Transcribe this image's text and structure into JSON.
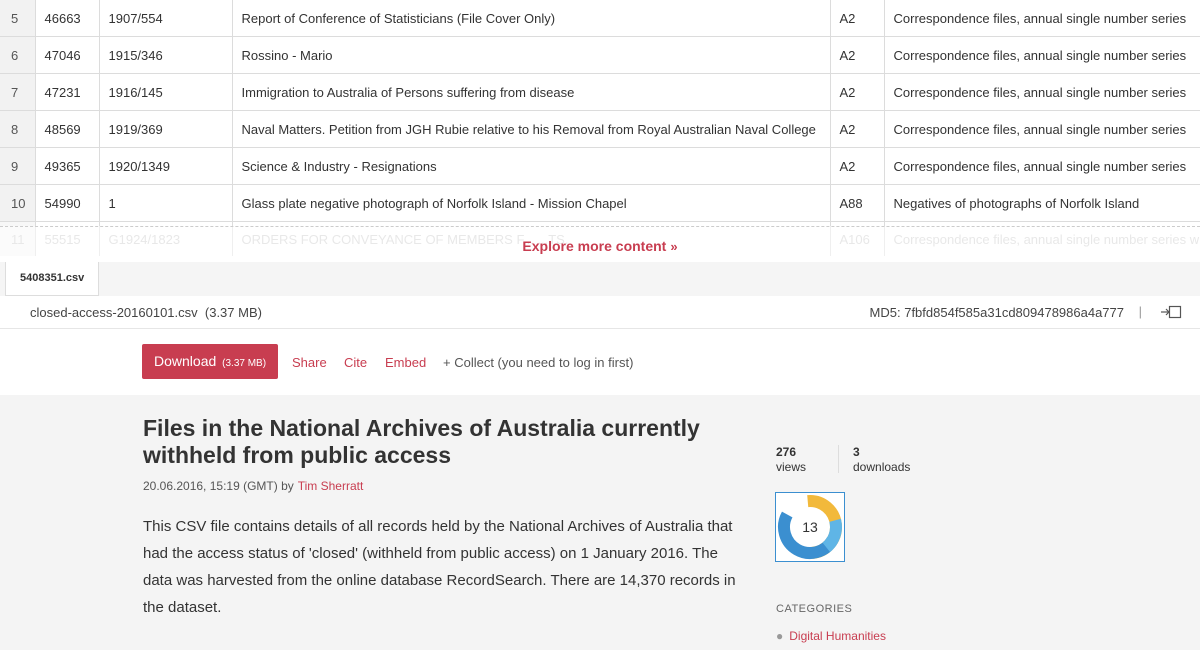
{
  "table": {
    "rows": [
      {
        "num": "5",
        "id": "46663",
        "control": "1907/554",
        "title": "Report of Conference of Statisticians (File Cover Only)",
        "series": "A2",
        "series_title": "Correspondence files, annual single number series"
      },
      {
        "num": "6",
        "id": "47046",
        "control": "1915/346",
        "title": "Rossino - Mario",
        "series": "A2",
        "series_title": "Correspondence files, annual single number series"
      },
      {
        "num": "7",
        "id": "47231",
        "control": "1916/145",
        "title": "Immigration to Australia of Persons suffering from disease",
        "series": "A2",
        "series_title": "Correspondence files, annual single number series"
      },
      {
        "num": "8",
        "id": "48569",
        "control": "1919/369",
        "title": "Naval Matters. Petition from JGH Rubie relative to his Removal from Royal Australian Naval College",
        "series": "A2",
        "series_title": "Correspondence files, annual single number series"
      },
      {
        "num": "9",
        "id": "49365",
        "control": "1920/1349",
        "title": "Science & Industry - Resignations",
        "series": "A2",
        "series_title": "Correspondence files, annual single number series"
      },
      {
        "num": "10",
        "id": "54990",
        "control": "1",
        "title": "Glass plate negative photograph of Norfolk Island - Mission Chapel",
        "series": "A88",
        "series_title": "Negatives of photographs of Norfolk Island"
      },
      {
        "num": "11",
        "id": "55515",
        "control": "G1924/1823",
        "title": "ORDERS FOR CONVEYANCE OF MEMBERS F... ...TS.",
        "series": "A106",
        "series_title": "Correspondence files, annual single number series with"
      }
    ],
    "explore_label": "Explore more content",
    "explore_icon": "double-chevron-down-icon"
  },
  "file_tab": {
    "label": "5408351.csv"
  },
  "file_info": {
    "filename": "closed-access-20160101.csv",
    "size": "(3.37 MB)",
    "md5": "MD5: 7fbfd854f585a31cd809478986a4a777",
    "separator": "|"
  },
  "actions": {
    "download_label": "Download",
    "download_size": "(3.37 MB)",
    "share": "Share",
    "cite": "Cite",
    "embed": "Embed",
    "collect": "+ Collect (you need to log in first)"
  },
  "article": {
    "title": "Files in the National Archives of Australia currently withheld from public access",
    "date": "20.06.2016, 15:19 (GMT) by",
    "author": "Tim Sherratt",
    "description": "This CSV file contains details of all records held by the National Archives of Australia that had the access status of 'closed' (withheld from public access) on 1 January 2016. The data was harvested from the online database RecordSearch. There are 14,370 records in the dataset."
  },
  "stats": {
    "views_count": "276",
    "views_label": "views",
    "downloads_count": "3",
    "downloads_label": "downloads"
  },
  "altmetric": {
    "score": "13"
  },
  "categories": {
    "label": "CATEGORIES",
    "items": [
      "Digital Humanities"
    ]
  },
  "colors": {
    "accent": "#c83d50",
    "altmetric_blue": "#3b8fd0",
    "altmetric_yellow": "#f2b93b"
  }
}
